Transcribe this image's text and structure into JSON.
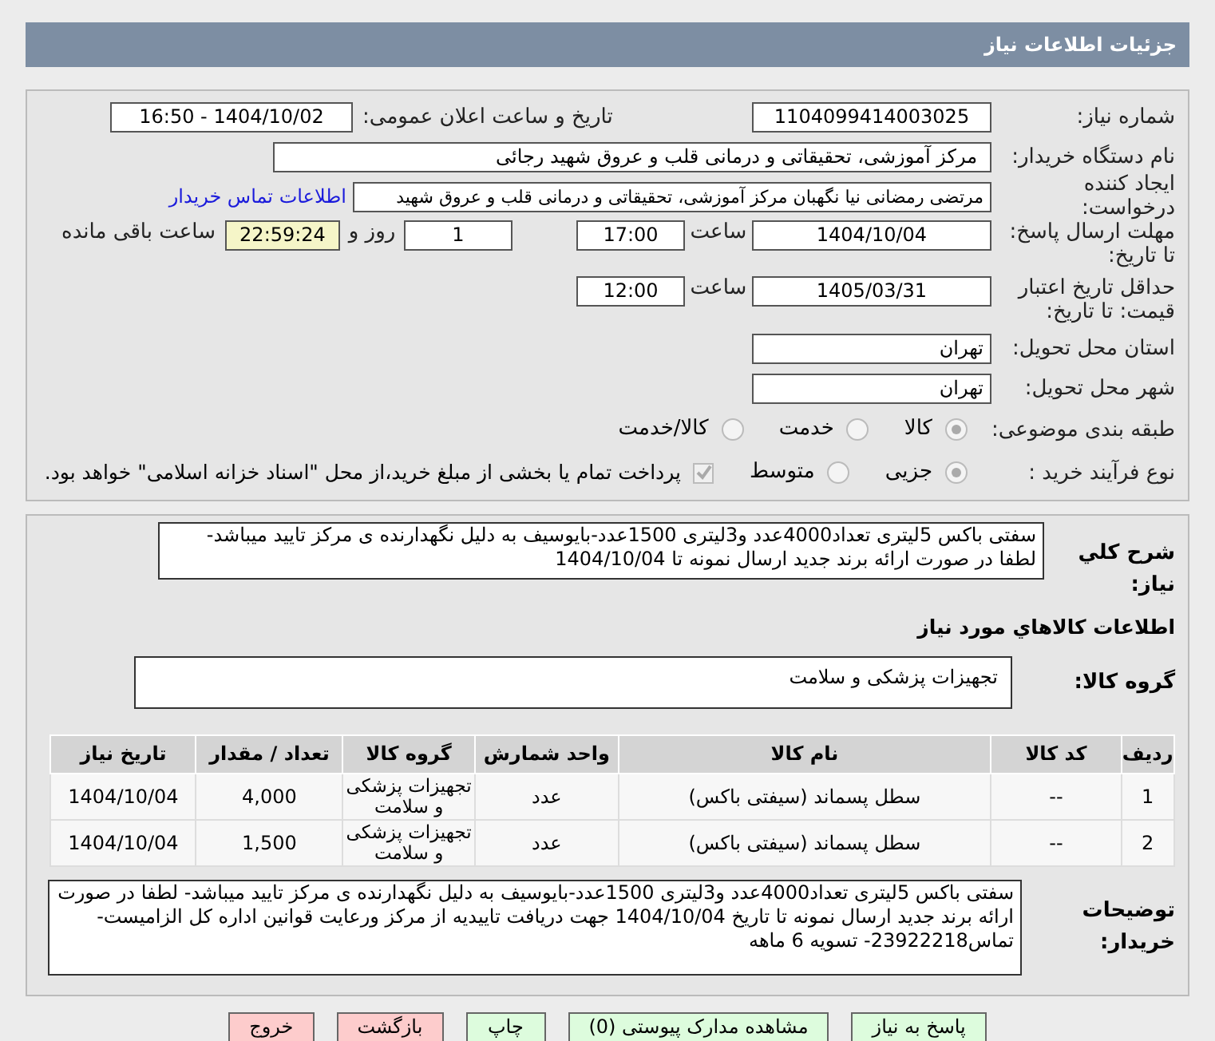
{
  "header": {
    "title": "جزئیات اطلاعات نیاز"
  },
  "need_number": {
    "label": "شماره نیاز:",
    "value": "1104099414003025"
  },
  "announce": {
    "label": "تاریخ و ساعت اعلان عمومی:",
    "value": "1404/10/02 - 16:50"
  },
  "buyer": {
    "label": "نام دستگاه خریدار:",
    "value": "مرکز آموزشی، تحقیقاتی و درمانی قلب و عروق شهید رجائی"
  },
  "creator": {
    "label": "ایجاد کننده درخواست:",
    "value": "مرتضی رمضانی نیا نگهبان مرکز آموزشی، تحقیقاتی و درمانی قلب و عروق شهید",
    "link": "اطلاعات تماس خریدار"
  },
  "reply_deadline": {
    "label": "مهلت ارسال پاسخ: تا تاریخ:",
    "date": "1404/10/04",
    "time_label": "ساعت",
    "time": "17:00",
    "days": "1",
    "days_label": "روز و",
    "remaining": "22:59:24",
    "remaining_label": "ساعت باقی مانده"
  },
  "price_validity": {
    "label": "حداقل تاریخ اعتبار قیمت: تا تاریخ:",
    "date": "1405/03/31",
    "time_label": "ساعت",
    "time": "12:00"
  },
  "province": {
    "label": "استان محل تحویل:",
    "value": "تهران"
  },
  "city": {
    "label": "شهر محل تحویل:",
    "value": "تهران"
  },
  "category": {
    "label": "طبقه بندی موضوعی:",
    "options": [
      {
        "label": "کالا",
        "selected": true
      },
      {
        "label": "خدمت",
        "selected": false
      },
      {
        "label": "کالا/خدمت",
        "selected": false
      }
    ]
  },
  "process": {
    "label": "نوع فرآیند خرید :",
    "options": [
      {
        "label": "جزیی",
        "selected": true
      },
      {
        "label": "متوسط",
        "selected": false
      }
    ],
    "checkbox": {
      "label": "پرداخت تمام یا بخشی از مبلغ خرید،از محل \"اسناد خزانه اسلامی\" خواهد بود.",
      "checked": true
    }
  },
  "description": {
    "label": "شرح کلي نياز:",
    "value": "سفتی باکس 5لیتری تعداد4000عدد و3لیتری 1500عدد-بایوسیف به دلیل نگهدارنده ی مرکز تایید میباشد- لطفا در صورت ارائه برند جدید ارسال نمونه تا 1404/10/04"
  },
  "goods_title": "اطلاعات کالاهاي مورد نياز",
  "goods_group": {
    "label": "گروه کالا:",
    "value": "تجهیزات پزشکی و سلامت"
  },
  "table": {
    "columns": [
      "ردیف",
      "کد کالا",
      "نام کالا",
      "واحد شمارش",
      "گروه کالا",
      "تعداد / مقدار",
      "تاریخ نیاز"
    ],
    "rows": [
      [
        "1",
        "--",
        "سطل پسماند (سیفتی باکس)",
        "عدد",
        "تجهیزات پزشکی و سلامت",
        "4,000",
        "1404/10/04"
      ],
      [
        "2",
        "--",
        "سطل پسماند (سیفتی باکس)",
        "عدد",
        "تجهیزات پزشکی و سلامت",
        "1,500",
        "1404/10/04"
      ]
    ]
  },
  "notes": {
    "label": "توضیحات خریدار:",
    "value": "سفتی باکس 5لیتری تعداد4000عدد و3لیتری 1500عدد-بایوسیف به دلیل نگهدارنده ی مرکز تایید میباشد- لطفا در صورت ارائه برند جدید ارسال نمونه تا تاریخ 1404/10/04 جهت دریافت تاییدیه از مرکز ورعایت قوانین اداره کل الزامیست- تماس23922218- تسویه 6 ماهه"
  },
  "buttons": [
    {
      "label": "پاسخ به نیاز",
      "kind": "green"
    },
    {
      "label": "مشاهده مدارک پیوستی (0)",
      "kind": "green"
    },
    {
      "label": "چاپ",
      "kind": "green"
    },
    {
      "label": "بازگشت",
      "kind": "red"
    },
    {
      "label": "خروج",
      "kind": "red"
    }
  ]
}
